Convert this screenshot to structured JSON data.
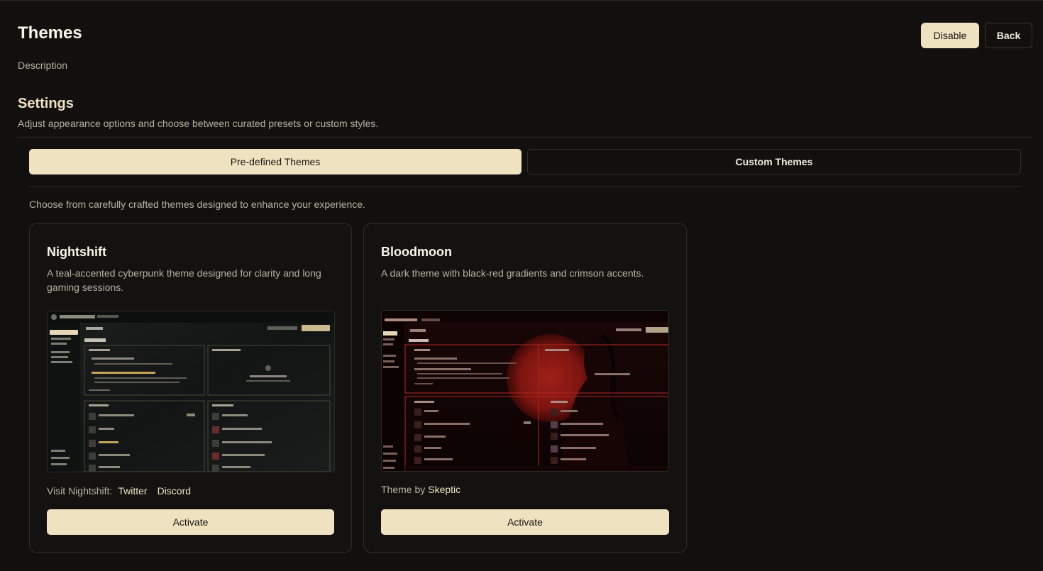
{
  "header": {
    "title": "Themes",
    "description": "Description",
    "disable_label": "Disable",
    "back_label": "Back"
  },
  "settings": {
    "title": "Settings",
    "description": "Adjust appearance options and choose between curated presets or custom styles."
  },
  "tabs": [
    {
      "label": "Pre-defined Themes",
      "active": true
    },
    {
      "label": "Custom Themes",
      "active": false
    }
  ],
  "intro": "Choose from carefully crafted themes designed to enhance your experience.",
  "themes": [
    {
      "name": "Nightshift",
      "description": "A teal-accented cyberpunk theme designed for clarity and long gaming sessions.",
      "footer_prefix": "Visit Nightshift:",
      "links": [
        "Twitter",
        "Discord"
      ],
      "activate_label": "Activate"
    },
    {
      "name": "Bloodmoon",
      "description": "A dark theme with black-red gradients and crimson accents.",
      "footer_prefix": "Theme by",
      "links": [
        "Skeptic"
      ],
      "activate_label": "Activate"
    }
  ],
  "colors": {
    "background": "#11100e",
    "accent": "#efe2c1",
    "nightshift_accent": "#c9a25a",
    "bloodmoon_accent": "#b3261e"
  }
}
